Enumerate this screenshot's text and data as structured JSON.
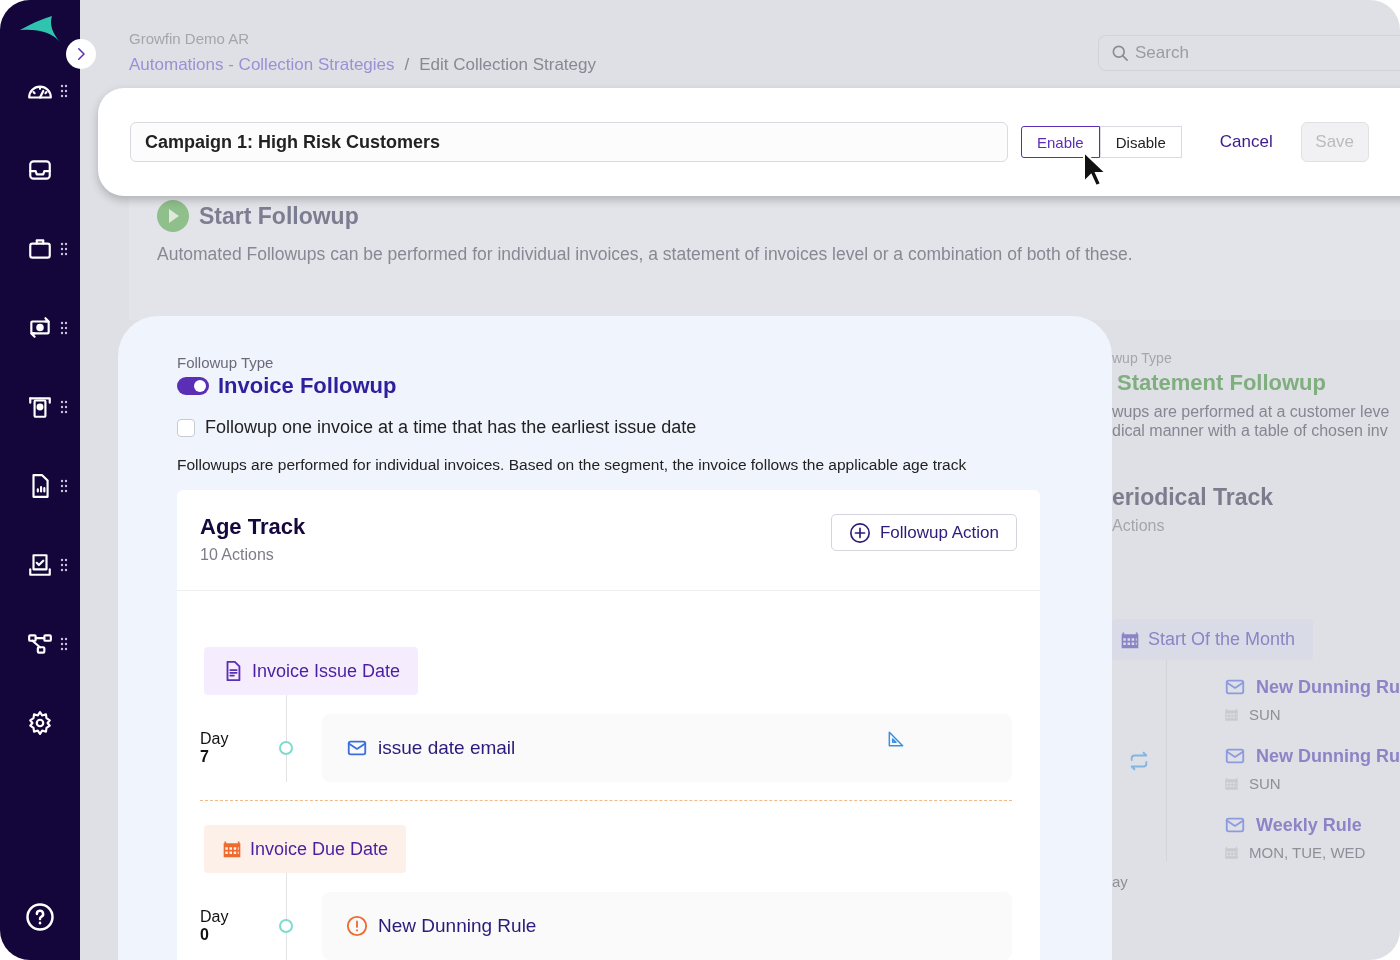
{
  "header": {
    "org": "Growfin Demo AR",
    "breadcrumb": [
      {
        "kind": "link",
        "label": "Automations - Collection Strategies"
      },
      {
        "kind": "current",
        "label": "Edit Collection Strategy"
      }
    ],
    "separator": "/",
    "search": {
      "placeholder": "Search"
    }
  },
  "strategy": {
    "name": "Campaign 1: High Risk Customers",
    "status": [
      {
        "label": "Enable",
        "selected": true
      },
      {
        "label": "Disable",
        "selected": false
      }
    ],
    "cancel": "Cancel",
    "save": {
      "label": "Save",
      "disabled": true
    }
  },
  "start_followup": {
    "title": "Start Followup",
    "description": "Automated Followups can be performed for individual invoices, a statement of invoices level or a combination of both of these."
  },
  "invoice_followup": {
    "label": "Followup Type",
    "title": "Invoice Followup",
    "on": true,
    "option": {
      "label": "Followup one invoice at a time that has the earliest issue date",
      "checked": false
    },
    "description": "Followups are performed for individual invoices. Based on the segment, the invoice follows the applicable age track",
    "age_track": {
      "title": "Age Track",
      "count": "10 Actions",
      "add_button": "Followup Action",
      "groups": [
        {
          "kind": "issue",
          "label": "Invoice Issue Date",
          "actions": [
            {
              "kind": "email",
              "day_label": "Day",
              "day": "7",
              "label": "issue date email",
              "tool": true
            }
          ]
        },
        {
          "kind": "due",
          "label": "Invoice Due Date",
          "actions": [
            {
              "kind": "alert",
              "day_label": "Day",
              "day": "0",
              "label": "New Dunning Rule",
              "tool": false
            }
          ]
        }
      ]
    }
  },
  "statement_followup": {
    "label": "wup Type",
    "title": "Statement Followup",
    "description": [
      "wups are performed at a customer leve",
      "dical manner with a table of chosen inv"
    ],
    "track": {
      "title": "eriodical Track",
      "count": "Actions",
      "start": "Start Of the Month",
      "day_label": "ay",
      "rules": [
        {
          "title": "New Dunning Ru",
          "days": "SUN"
        },
        {
          "title": "New Dunning Ru",
          "days": "SUN"
        },
        {
          "title": "Weekly Rule",
          "days": "MON, TUE, WED"
        }
      ]
    }
  }
}
